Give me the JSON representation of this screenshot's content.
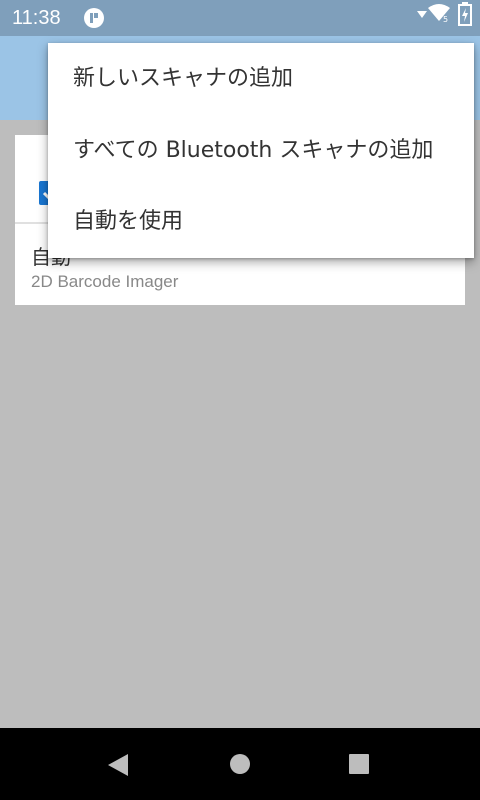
{
  "status_bar": {
    "time": "11:38",
    "icons": [
      "app-indicator-icon",
      "signal-icon",
      "wifi-icon",
      "battery-charging-icon"
    ]
  },
  "colors": {
    "status_bar": "#7f9fbb",
    "app_bar": "#9bc4e6",
    "scrim": "#bdbdbd",
    "nav_bar": "#000000",
    "checkbox": "#1976d2"
  },
  "scanner_list": {
    "items": [
      {
        "title": "自動",
        "subtitle": "2D Barcode Imager"
      }
    ]
  },
  "overflow_menu": {
    "items": [
      {
        "label": "新しいスキャナの追加"
      },
      {
        "label": "すべての Bluetooth スキャナの追加"
      },
      {
        "label": "自動を使用"
      }
    ]
  },
  "nav_bar": {
    "icons": [
      "back-icon",
      "home-icon",
      "recent-apps-icon"
    ]
  }
}
